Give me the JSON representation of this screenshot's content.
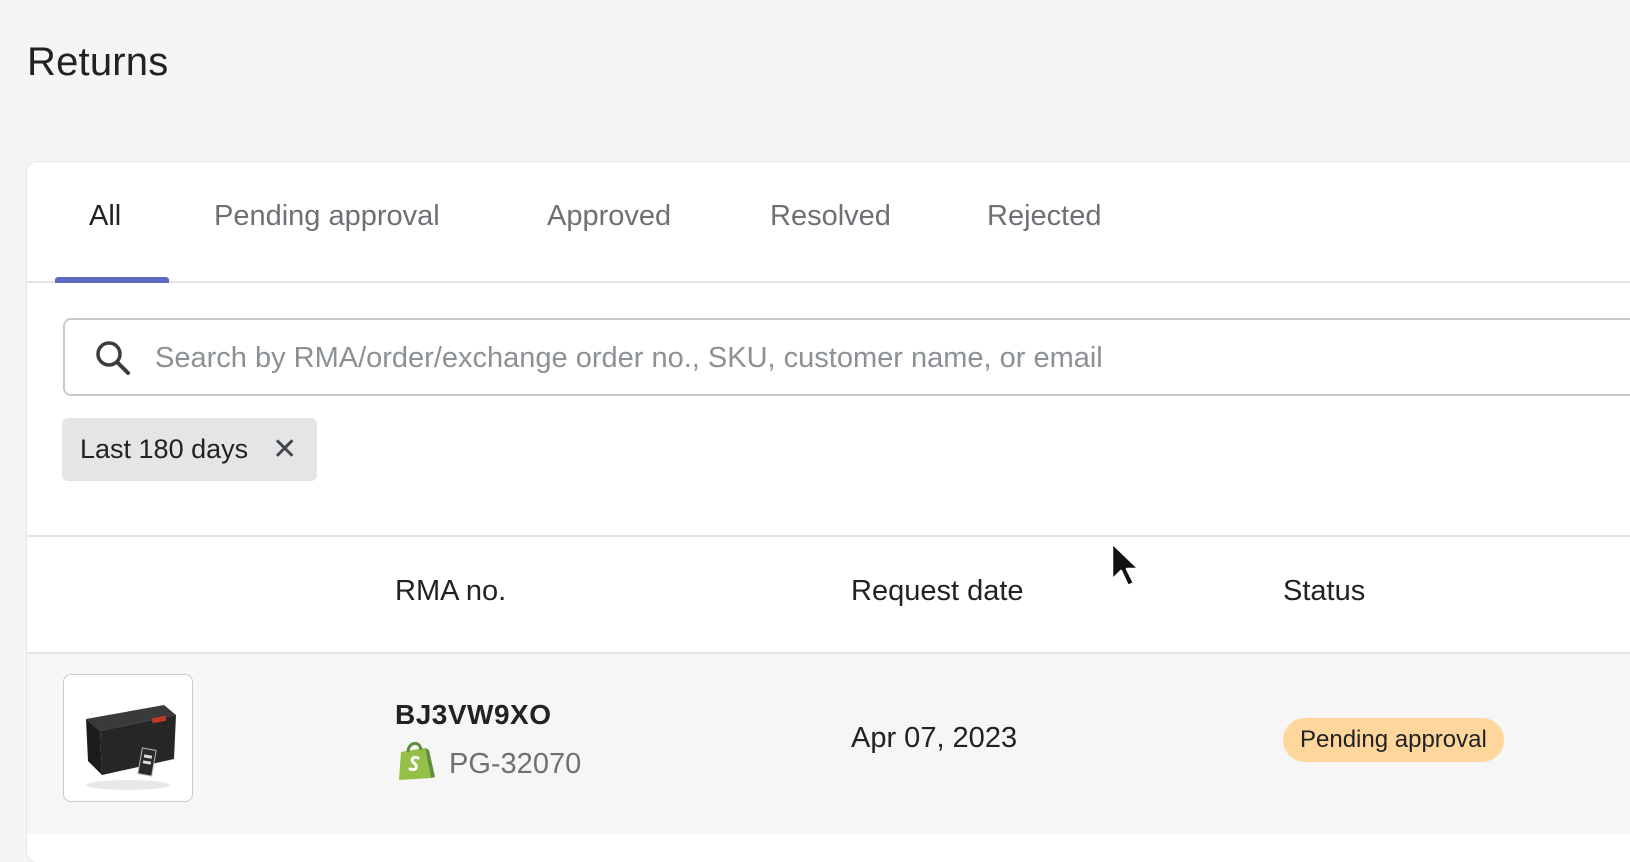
{
  "page": {
    "title": "Returns"
  },
  "tabs": [
    {
      "label": "All"
    },
    {
      "label": "Pending approval"
    },
    {
      "label": "Approved"
    },
    {
      "label": "Resolved"
    },
    {
      "label": "Rejected"
    }
  ],
  "search": {
    "placeholder": "Search by RMA/order/exchange order no., SKU, customer name, or email",
    "value": ""
  },
  "filters": [
    {
      "label": "Last 180 days"
    }
  ],
  "table": {
    "columns": [
      "RMA no.",
      "Request date",
      "Status"
    ],
    "rows": [
      {
        "rma": "BJ3VW9XO",
        "order": "PG-32070",
        "request_date": "Apr 07, 2023",
        "status": "Pending approval"
      }
    ]
  },
  "colors": {
    "accent": "#5c6ac4",
    "status_pending": "#ffd79d",
    "shopify_green": "#95bf47"
  },
  "icons": [
    "search-icon",
    "close-icon",
    "shopify-icon",
    "mouse-cursor"
  ]
}
